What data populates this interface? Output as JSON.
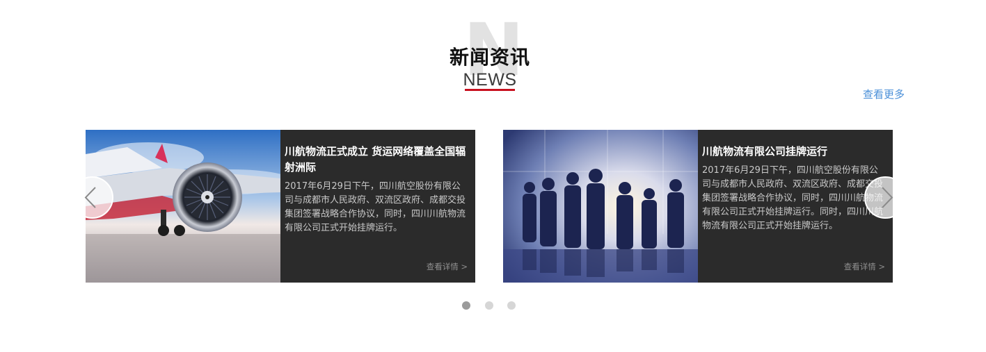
{
  "section": {
    "bg_letter": "N",
    "title_cn": "新闻资讯",
    "title_en": "NEWS",
    "more_link": "查看更多",
    "accent_color": "#c8101e",
    "link_color": "#4a8fd8"
  },
  "news": [
    {
      "title": "川航物流正式成立 货运网络覆盖全国辐射洲际",
      "description": "2017年6月29日下午，四川航空股份有限公司与成都市人民政府、双流区政府、成都交投集团签署战略合作协议，同时，四川川航物流有限公司正式开始挂牌运行。",
      "detail_link": "查看详情 >",
      "image_icon": "airplane-engine-photo"
    },
    {
      "title": "川航物流有限公司挂牌运行",
      "description": "2017年6月29日下午，四川航空股份有限公司与成都市人民政府、双流区政府、成都交投集团签署战略合作协议，同时，四川川航物流有限公司正式开始挂牌运行。同时，四川川航物流有限公司正式开始挂牌运行。",
      "detail_link": "查看详情 >",
      "image_icon": "business-team-silhouette-photo"
    }
  ],
  "carousel": {
    "prev_icon": "chevron-left-icon",
    "next_icon": "chevron-right-icon",
    "dot_count": 3,
    "active_index": 0
  }
}
